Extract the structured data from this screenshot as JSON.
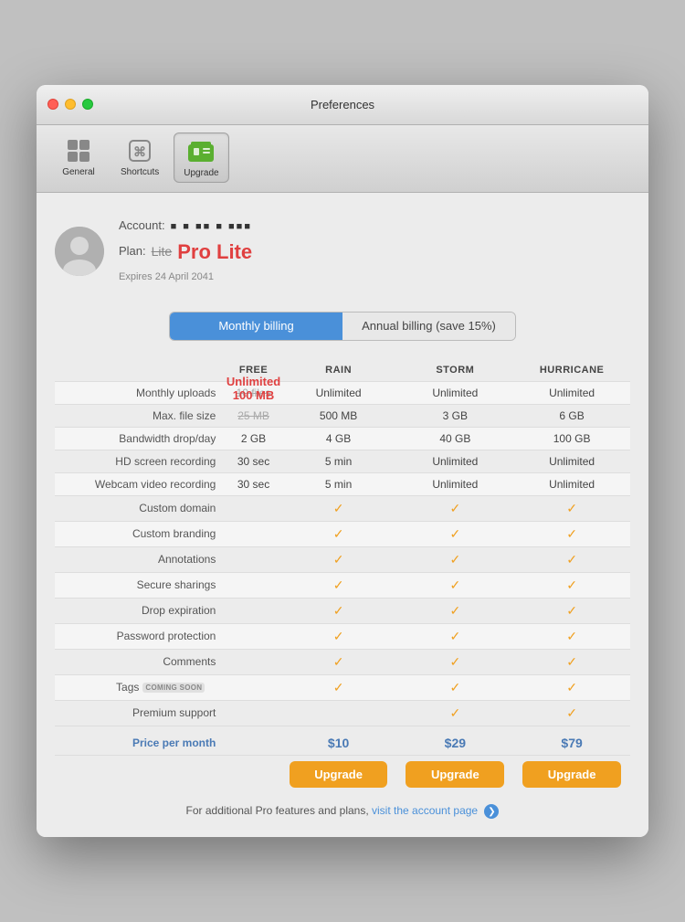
{
  "window": {
    "title": "Preferences"
  },
  "toolbar": {
    "buttons": [
      {
        "id": "general",
        "label": "General",
        "icon": "🖥️",
        "active": false
      },
      {
        "id": "shortcuts",
        "label": "Shortcuts",
        "icon": "⌘",
        "active": false
      },
      {
        "id": "upgrade",
        "label": "Upgrade",
        "icon": "🪪",
        "active": true
      }
    ]
  },
  "account": {
    "label": "Account:",
    "dots": "■ ■ ■■ ■ ■■■",
    "plan_label": "Plan:",
    "plan_lite": "Lite",
    "plan_pro_lite": "Pro Lite",
    "expires": "Expires 24 April 2041"
  },
  "billing": {
    "monthly_label": "Monthly billing",
    "annual_label": "Annual billing (save 15%)"
  },
  "table": {
    "headers": [
      "",
      "FREE",
      "RAIN",
      "STORM",
      "HURRICANE"
    ],
    "rows": [
      {
        "label": "Monthly uploads",
        "free": "10 files",
        "rain": "Unlimited",
        "storm": "Unlimited",
        "hurricane": "Unlimited",
        "free_overlay": "Unlimited",
        "free_overlay2": "100 MB"
      },
      {
        "label": "Max. file size",
        "free": "25 MB",
        "rain": "500 MB",
        "storm": "3 GB",
        "hurricane": "6 GB"
      },
      {
        "label": "Bandwidth drop/day",
        "free": "2 GB",
        "rain": "4 GB",
        "storm": "40 GB",
        "hurricane": "100 GB"
      },
      {
        "label": "HD screen recording",
        "free": "30 sec",
        "rain": "5 min",
        "storm": "Unlimited",
        "hurricane": "Unlimited"
      },
      {
        "label": "Webcam video recording",
        "free": "30 sec",
        "rain": "5 min",
        "storm": "Unlimited",
        "hurricane": "Unlimited"
      },
      {
        "label": "Custom domain",
        "free": "",
        "rain": "✓",
        "storm": "✓",
        "hurricane": "✓"
      },
      {
        "label": "Custom branding",
        "free": "",
        "rain": "✓",
        "storm": "✓",
        "hurricane": "✓"
      },
      {
        "label": "Annotations",
        "free": "",
        "rain": "✓",
        "storm": "✓",
        "hurricane": "✓"
      },
      {
        "label": "Secure sharings",
        "free": "",
        "rain": "✓",
        "storm": "✓",
        "hurricane": "✓"
      },
      {
        "label": "Drop expiration",
        "free": "",
        "rain": "✓",
        "storm": "✓",
        "hurricane": "✓"
      },
      {
        "label": "Password protection",
        "free": "",
        "rain": "✓",
        "storm": "✓",
        "hurricane": "✓"
      },
      {
        "label": "Comments",
        "free": "",
        "rain": "✓",
        "storm": "✓",
        "hurricane": "✓"
      },
      {
        "label": "Tags",
        "free": "",
        "rain": "✓",
        "storm": "✓",
        "hurricane": "✓",
        "coming_soon": true
      },
      {
        "label": "Premium support",
        "free": "",
        "rain": "",
        "storm": "✓",
        "hurricane": "✓"
      }
    ],
    "price_label": "Price per month",
    "prices": {
      "free": "",
      "rain": "$10",
      "storm": "$29",
      "hurricane": "$79"
    },
    "upgrade_label": "Upgrade"
  },
  "footer": {
    "text": "For additional Pro features and plans,",
    "link_text": "visit the account page",
    "arrow": "❯"
  }
}
